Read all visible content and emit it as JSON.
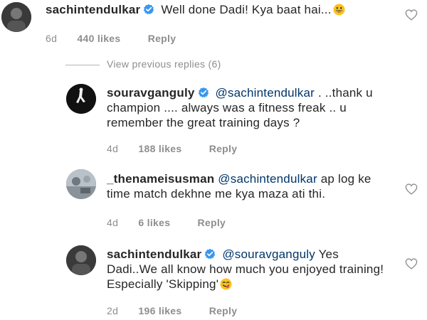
{
  "comments": [
    {
      "username": "sachintendulkar",
      "verified": true,
      "mention": "",
      "text": "Well done Dadi! Kya baat hai...",
      "emoji": "grinning-face-icon",
      "time": "6d",
      "likes": "440 likes",
      "reply": "Reply"
    },
    {
      "username": "souravganguly",
      "verified": true,
      "mention": "@sachintendulkar",
      "text": ". ..thank u champion .... always was a fitness freak .. u remember the great training days ?",
      "time": "4d",
      "likes": "188 likes",
      "reply": "Reply"
    },
    {
      "username": "_thenameisusman",
      "verified": false,
      "mention": "@sachintendulkar",
      "text": "ap log ke time match dekhne me kya maza ati thi.",
      "time": "4d",
      "likes": "6 likes",
      "reply": "Reply"
    },
    {
      "username": "sachintendulkar",
      "verified": true,
      "mention": "@souravganguly",
      "text": "Yes Dadi..We all know how much you enjoyed training! Especially 'Skipping'",
      "emoji": "face-savoring-food-icon",
      "time": "2d",
      "likes": "196 likes",
      "reply": "Reply"
    }
  ],
  "view_previous_replies": "View previous replies (6)",
  "colors": {
    "text": "#262626",
    "meta": "#8e8e8e",
    "mention": "#003569",
    "verified": "#3897f0"
  }
}
